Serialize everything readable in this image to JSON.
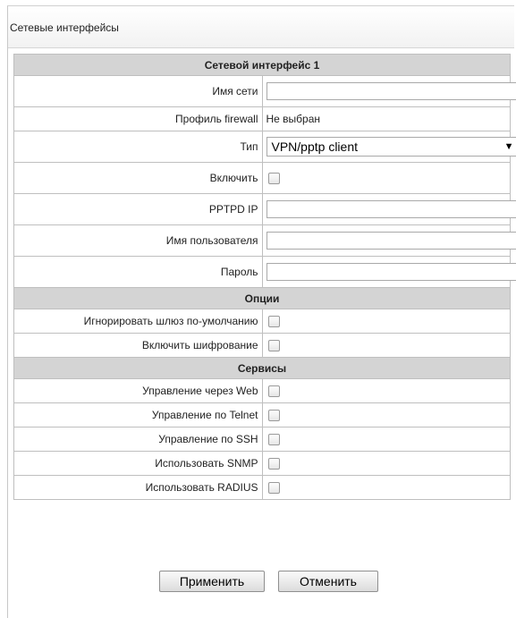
{
  "panel": {
    "title": "Сетевые интерфейсы"
  },
  "section_main": {
    "header": "Сетевой интерфейс 1",
    "network_name_label": "Имя сети",
    "network_name_value": "",
    "firewall_label": "Профиль firewall",
    "firewall_value": "Не выбран",
    "type_label": "Тип",
    "type_value": "VPN/pptp client",
    "enable_label": "Включить",
    "enable_checked": false,
    "pptpd_ip_label": "PPTPD IP",
    "pptpd_ip_value": "",
    "username_label": "Имя пользователя",
    "username_value": "",
    "password_label": "Пароль",
    "password_value": ""
  },
  "section_options": {
    "header": "Опции",
    "ignore_gateway_label": "Игнорировать шлюз по-умолчанию",
    "ignore_gateway_checked": false,
    "encryption_label": "Включить шифрование",
    "encryption_checked": false
  },
  "section_services": {
    "header": "Сервисы",
    "web_label": "Управление через Web",
    "telnet_label": "Управление по Telnet",
    "ssh_label": "Управление по SSH",
    "snmp_label": "Использовать SNMP",
    "radius_label": "Использовать RADIUS"
  },
  "buttons": {
    "apply": "Применить",
    "cancel": "Отменить"
  }
}
